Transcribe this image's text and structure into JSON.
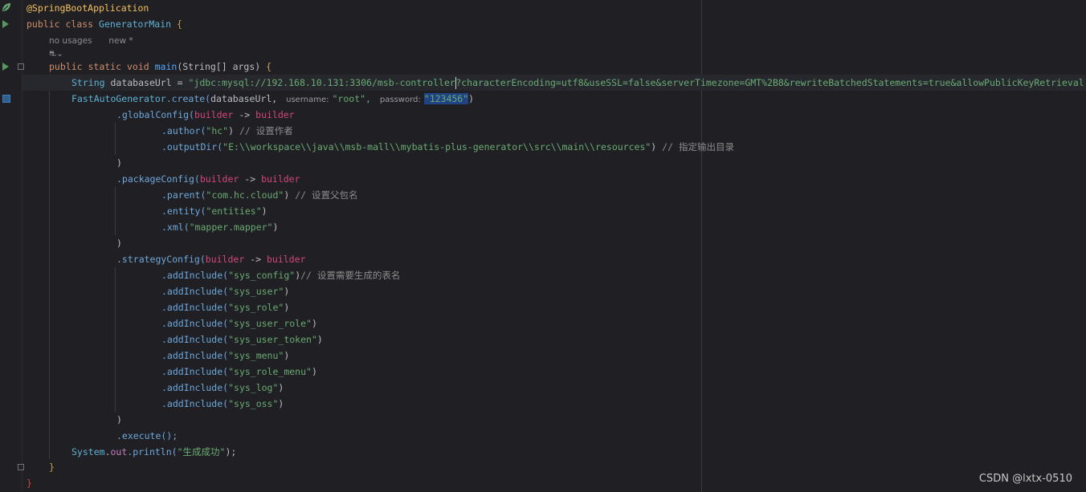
{
  "code": {
    "l1": {
      "annotation": "@SpringBootApplication"
    },
    "l2": {
      "kw_public": "public",
      "kw_class": "class",
      "class_name": "GeneratorMain",
      "brace": "{"
    },
    "l3": {
      "usages": "no usages",
      "new": "new *"
    },
    "l4": {
      "author_icon": "⛐",
      "chevron": "⌄"
    },
    "l5": {
      "kw1": "public",
      "kw2": "static",
      "kw3": "void",
      "name": "main",
      "open": "(",
      "type": "String[]",
      "arg": "args",
      "close": ")",
      "brace": "{"
    },
    "l6": {
      "type": "String",
      "var": "databaseUrl",
      "eq": "=",
      "str_before": "\"jdbc:mysql://192.168.10.131:3306/msb-controller",
      "str_after": "?characterEncoding=utf8&useSSL=false&serverTimezone=GMT%2B8&rewriteBatchedStatements=true&allowPublicKeyRetrieval"
    },
    "l7": {
      "cls": "FastAutoGenerator",
      "method": ".create(",
      "arg": "databaseUrl,",
      "hint_user": "username:",
      "user": "\"root\",",
      "hint_pass": "password:",
      "pass": "\"123456\"",
      "close": ")"
    },
    "l8": {
      "method": ".globalConfig(",
      "p1": "builder",
      "arrow": "->",
      "p2": "builder"
    },
    "l9": {
      "method": ".author(",
      "str": "\"hc\"",
      "close": ")",
      "comment": "// 设置作者"
    },
    "l10": {
      "method": ".outputDir(",
      "str": "\"E:\\\\workspace\\\\java\\\\msb-mall\\\\mybatis-plus-generator\\\\src\\\\main\\\\resources\"",
      "close": ")",
      "comment": "// 指定输出目录"
    },
    "l11": {
      "close": ")"
    },
    "l12": {
      "method": ".packageConfig(",
      "p1": "builder",
      "arrow": "->",
      "p2": "builder"
    },
    "l13": {
      "method": ".parent(",
      "str": "\"com.hc.cloud\"",
      "close": ")",
      "comment": "// 设置父包名"
    },
    "l14": {
      "method": ".entity(",
      "str": "\"entities\"",
      "close": ")"
    },
    "l15": {
      "method": ".xml(",
      "str": "\"mapper.mapper\"",
      "close": ")"
    },
    "l16": {
      "close": ")"
    },
    "l17": {
      "method": ".strategyConfig(",
      "p1": "builder",
      "arrow": "->",
      "p2": "builder"
    },
    "l18": {
      "method": ".addInclude(",
      "str": "\"sys_config\"",
      "close": ")",
      "comment": "// 设置需要生成的表名"
    },
    "l19": {
      "method": ".addInclude(",
      "str": "\"sys_user\"",
      "close": ")"
    },
    "l20": {
      "method": ".addInclude(",
      "str": "\"sys_role\"",
      "close": ")"
    },
    "l21": {
      "method": ".addInclude(",
      "str": "\"sys_user_role\"",
      "close": ")"
    },
    "l22": {
      "method": ".addInclude(",
      "str": "\"sys_user_token\"",
      "close": ")"
    },
    "l23": {
      "method": ".addInclude(",
      "str": "\"sys_menu\"",
      "close": ")"
    },
    "l24": {
      "method": ".addInclude(",
      "str": "\"sys_role_menu\"",
      "close": ")"
    },
    "l25": {
      "method": ".addInclude(",
      "str": "\"sys_log\"",
      "close": ")"
    },
    "l26": {
      "method": ".addInclude(",
      "str": "\"sys_oss\"",
      "close": ")"
    },
    "l27": {
      "close": ")"
    },
    "l28": {
      "method": ".execute();"
    },
    "l29": {
      "cls": "System",
      "dot": ".",
      "field": "out",
      "method": ".println(",
      "str": "\"生成成功\"",
      "close": ");"
    },
    "l30": {
      "brace": "}"
    },
    "l31": {
      "brace": "}"
    }
  },
  "watermark": "CSDN @lxtx-0510",
  "icons": {
    "run": "run-triangle-icon",
    "spring": "spring-leaf-icon",
    "fold": "fold-icon",
    "bookmark": "bookmark-icon"
  },
  "colors": {
    "background": "#1f1f24",
    "keyword": "#cf8e6d",
    "string": "#6aab73",
    "annotation": "#f5c05c",
    "lambda_param": "#d5477a",
    "selection": "#214283"
  }
}
